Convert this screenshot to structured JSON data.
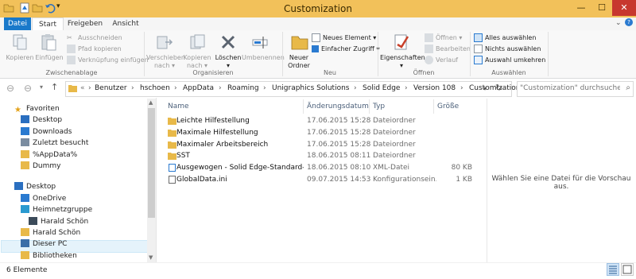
{
  "window": {
    "title": "Customization",
    "controls": {
      "minimize": "—",
      "maximize": "☐",
      "close": "✕"
    },
    "accent": "#f2c15a",
    "close_color": "#c7372e"
  },
  "ribbon": {
    "tabs": [
      "Datei",
      "Start",
      "Freigeben",
      "Ansicht"
    ],
    "groups": {
      "clipboard": {
        "label": "Zwischenablage",
        "copy": "Kopieren",
        "paste": "Einfügen",
        "cut": "Ausschneiden",
        "copy_path": "Pfad kopieren",
        "paste_shortcut": "Verknüpfung einfügen"
      },
      "organize": {
        "label": "Organisieren",
        "move_to": [
          "Verschieben",
          "nach"
        ],
        "copy_to": [
          "Kopieren",
          "nach"
        ],
        "delete": "Löschen",
        "rename": "Umbenennen"
      },
      "new": {
        "label": "Neu",
        "new_folder": [
          "Neuer",
          "Ordner"
        ],
        "new_item": "Neues Element",
        "easy_access": "Einfacher Zugriff"
      },
      "open": {
        "label": "Öffnen",
        "properties": "Eigenschaften",
        "open": "Öffnen",
        "edit": "Bearbeiten",
        "history": "Verlauf"
      },
      "select": {
        "label": "Auswählen",
        "select_all": "Alles auswählen",
        "select_none": "Nichts auswählen",
        "invert": "Auswahl umkehren"
      }
    }
  },
  "address": {
    "overflow": "«",
    "crumbs": [
      "Benutzer",
      "hschoen",
      "AppData",
      "Roaming",
      "Unigraphics Solutions",
      "Solid Edge",
      "Version 108",
      "Customization"
    ],
    "search_placeholder": "\"Customization\" durchsuchen"
  },
  "nav": {
    "favorites": {
      "label": "Favoriten",
      "items": [
        "Desktop",
        "Downloads",
        "Zuletzt besucht",
        "%AppData%",
        "Dummy"
      ]
    },
    "desktop": {
      "label": "Desktop",
      "items": [
        "OneDrive",
        "Heimnetzgruppe",
        "Harald Schön",
        "Harald Schön",
        "Dieser PC",
        "Bibliotheken"
      ]
    }
  },
  "columns": [
    "Name",
    "Änderungsdatum",
    "Typ",
    "Größe"
  ],
  "files": [
    {
      "name": "Leichte Hilfestellung",
      "date": "17.06.2015 15:28",
      "type": "Dateiordner",
      "size": "",
      "icon": "folder-icon"
    },
    {
      "name": "Maximale Hilfestellung",
      "date": "17.06.2015 15:28",
      "type": "Dateiordner",
      "size": "",
      "icon": "folder-icon"
    },
    {
      "name": "Maximaler Arbeitsbereich",
      "date": "17.06.2015 15:28",
      "type": "Dateiordner",
      "size": "",
      "icon": "folder-icon"
    },
    {
      "name": "SST",
      "date": "18.06.2015 08:11",
      "type": "Dateiordner",
      "size": "",
      "icon": "folder-icon"
    },
    {
      "name": "Ausgewogen - Solid Edge-Standard-Layo...",
      "date": "18.06.2015 08:10",
      "type": "XML-Datei",
      "size": "80 KB",
      "icon": "xml-file-icon"
    },
    {
      "name": "GlobalData.ini",
      "date": "09.07.2015 14:53",
      "type": "Konfigurationsein...",
      "size": "1 KB",
      "icon": "ini-file-icon"
    }
  ],
  "preview": {
    "text": "Wählen Sie eine Datei für die Vorschau aus."
  },
  "status": {
    "count": "6 Elemente"
  }
}
